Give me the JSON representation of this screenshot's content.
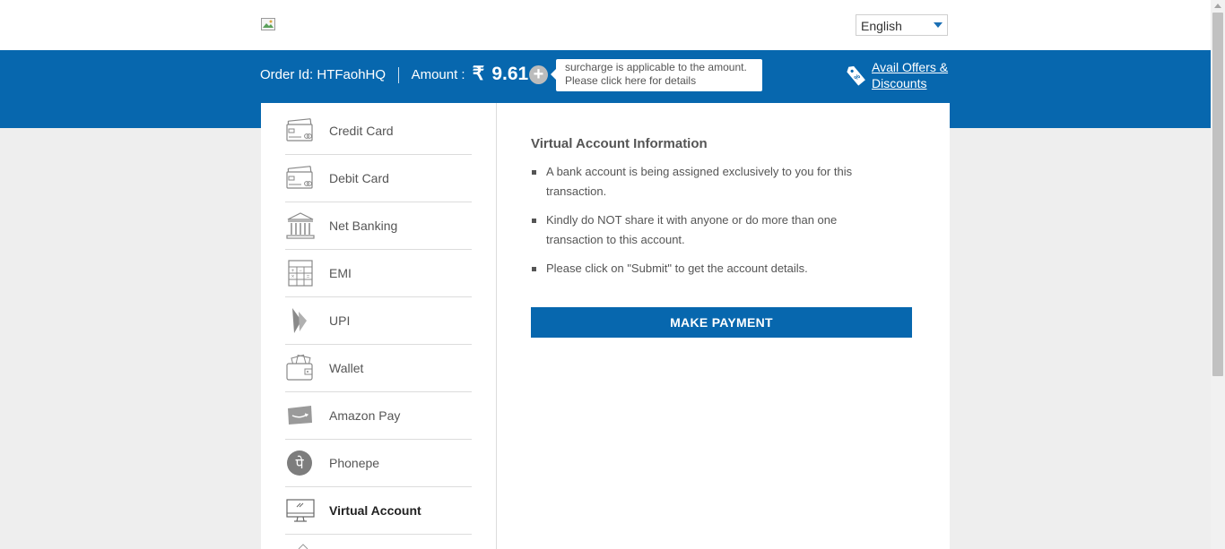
{
  "header": {
    "language": {
      "selected": "English"
    }
  },
  "order": {
    "id_label": "Order Id:",
    "id_value": "HTFaohHQ",
    "amount_label": "Amount :",
    "currency_symbol": "₹",
    "amount_value": "9.61",
    "surcharge_tooltip": "surcharge is applicable to the amount. Please click here for details",
    "offers_link": "Avail Offers & Discounts"
  },
  "sidebar": {
    "items": [
      {
        "label": "Credit Card",
        "icon": "credit-card-icon"
      },
      {
        "label": "Debit Card",
        "icon": "debit-card-icon"
      },
      {
        "label": "Net Banking",
        "icon": "bank-icon"
      },
      {
        "label": "EMI",
        "icon": "calculator-icon"
      },
      {
        "label": "UPI",
        "icon": "upi-icon"
      },
      {
        "label": "Wallet",
        "icon": "wallet-icon"
      },
      {
        "label": "Amazon Pay",
        "icon": "amazon-pay-icon"
      },
      {
        "label": "Phonepe",
        "icon": "phonepe-icon"
      },
      {
        "label": "Virtual Account",
        "icon": "monitor-icon",
        "active": true
      }
    ]
  },
  "content": {
    "title": "Virtual Account Information",
    "bullets": [
      "A bank account is being assigned exclusively to you for this transaction.",
      "Kindly do NOT share it with anyone or do more than one transaction to this account.",
      "Please click on \"Submit\" to get the account details."
    ],
    "pay_button": "MAKE PAYMENT"
  },
  "colors": {
    "brand_blue": "#0767ae",
    "background": "#eeeeee"
  }
}
